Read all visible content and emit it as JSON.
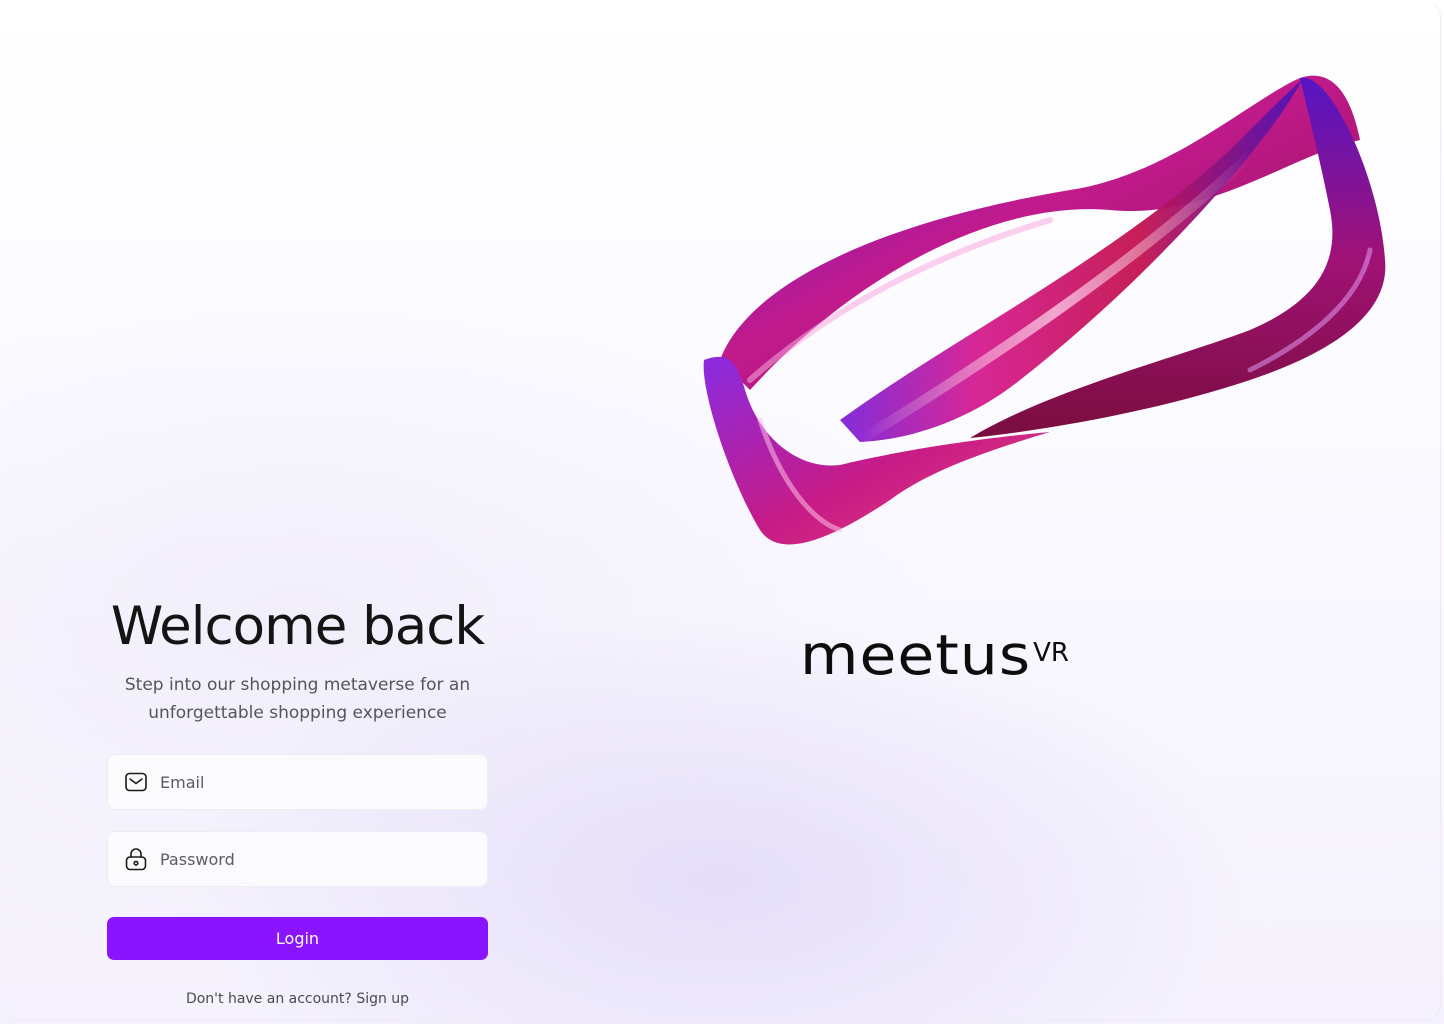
{
  "brand": {
    "name": "meetus",
    "suffix": "VR"
  },
  "login": {
    "title": "Welcome back",
    "subtitle": "Step into our shopping metaverse for an unforgettable shopping experience",
    "email_placeholder": "Email",
    "password_placeholder": "Password",
    "button_label": "Login",
    "signup_prompt": "Don't have an account?",
    "signup_link": "Sign up"
  },
  "colors": {
    "accent": "#8B14FF",
    "ribbon_primary": "#C21A8A",
    "ribbon_secondary": "#5A17C9"
  },
  "icons": {
    "email": "envelope-icon",
    "password": "lock-icon"
  }
}
